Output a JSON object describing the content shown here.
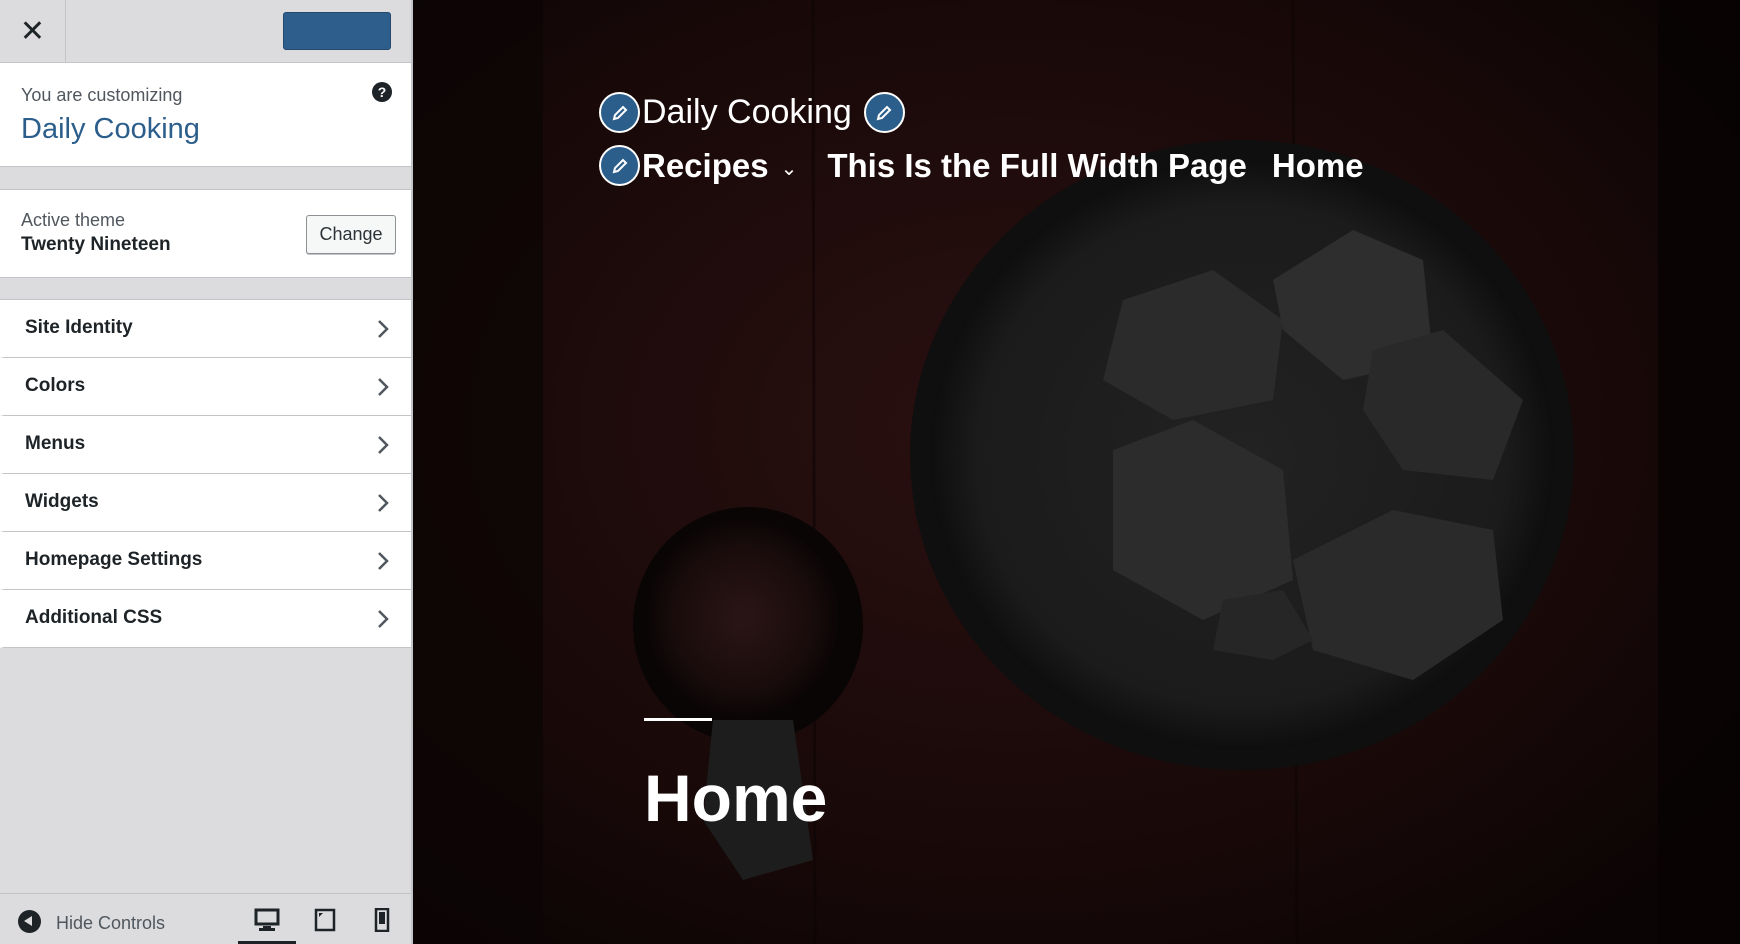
{
  "sidebar": {
    "close_icon": "close-icon",
    "info": {
      "label": "You are customizing",
      "site_name": "Daily Cooking",
      "help_icon": "?"
    },
    "theme": {
      "label": "Active theme",
      "name": "Twenty Nineteen",
      "change_label": "Change"
    },
    "items": [
      {
        "label": "Site Identity"
      },
      {
        "label": "Colors"
      },
      {
        "label": "Menus"
      },
      {
        "label": "Widgets"
      },
      {
        "label": "Homepage Settings"
      },
      {
        "label": "Additional CSS"
      }
    ],
    "footer": {
      "hide_label": "Hide Controls",
      "devices": [
        "desktop",
        "tablet",
        "mobile"
      ],
      "active_device": "desktop"
    }
  },
  "preview": {
    "site_title": "Daily Cooking",
    "nav": {
      "recipes": "Recipes",
      "full_width": "This Is the Full Width Page",
      "home": "Home"
    },
    "page_heading": "Home"
  },
  "colors": {
    "accent": "#2c5e8c",
    "publish": "#2e5e8c",
    "sidebar_bg": "#dcdcde"
  }
}
